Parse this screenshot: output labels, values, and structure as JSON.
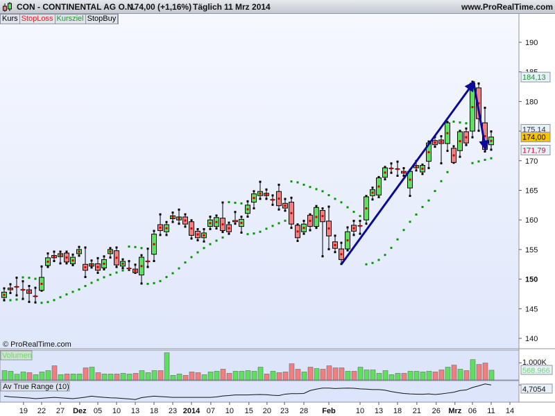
{
  "header": {
    "title": "CON - CONTINENTAL AG O.N.",
    "price_change": "174,00 (+1,16%)",
    "period": "Täglich",
    "date": "11 Mrz 2014",
    "site": "www.ProRealTime.com"
  },
  "buttons": [
    {
      "label": "Kurs",
      "color": "#000000"
    },
    {
      "label": "StopLoss",
      "color": "#e0202a"
    },
    {
      "label": "Kursziel",
      "color": "#1a9a2a"
    },
    {
      "label": "StopBuy",
      "color": "#000000"
    }
  ],
  "copyright": "© ProRealTime.com",
  "colors": {
    "up": "#5ee05e",
    "down": "#f08080",
    "sar": "#009a00",
    "mid": "#d40000",
    "arrow": "#0a0a9a"
  },
  "price_axis": {
    "ticks": [
      190,
      185,
      180,
      175,
      170,
      165,
      160,
      155,
      150,
      145,
      140
    ],
    "bold_tick": 150,
    "range": [
      139,
      194
    ]
  },
  "price_labels": [
    {
      "text": "184,13",
      "value": 184.13,
      "fg": "#1a9a2a",
      "bg": "#e8f0f8"
    },
    {
      "text": "175,14",
      "value": 175.3,
      "fg": "#333333",
      "bg": "#e8f0f8"
    },
    {
      "text": "174,00",
      "value": 174.0,
      "fg": "#000000",
      "bg": "#f5c400"
    },
    {
      "text": "171,79",
      "value": 171.79,
      "fg": "#d01040",
      "bg": "#e8f0f8"
    }
  ],
  "candles": [
    [
      146.9,
      148.5,
      146.4,
      147.8
    ],
    [
      148.2,
      149.2,
      147.6,
      148.5
    ],
    [
      148.7,
      150.3,
      147.2,
      148.7
    ],
    [
      148.2,
      149.7,
      146.6,
      148.2
    ],
    [
      148.2,
      148.9,
      146.1,
      147.6
    ],
    [
      147.1,
      148.6,
      146.0,
      147.1
    ],
    [
      148.1,
      152.2,
      148.0,
      150.3
    ],
    [
      152.3,
      154.4,
      152.0,
      153.6
    ],
    [
      154.0,
      154.7,
      153.0,
      153.6
    ],
    [
      153.8,
      154.7,
      152.6,
      154.3
    ],
    [
      154.4,
      154.7,
      152.6,
      152.9
    ],
    [
      152.6,
      154.2,
      152.3,
      153.7
    ],
    [
      154.3,
      155.5,
      153.9,
      155.0
    ],
    [
      152.5,
      155.4,
      150.3,
      151.5
    ],
    [
      152.2,
      153.2,
      151.9,
      152.6
    ],
    [
      152.6,
      153.6,
      151.0,
      151.5
    ],
    [
      151.9,
      153.9,
      151.6,
      153.3
    ],
    [
      154.3,
      155.3,
      153.6,
      155.0
    ],
    [
      154.8,
      155.4,
      152.0,
      152.4
    ],
    [
      152.2,
      153.4,
      151.8,
      153.0
    ],
    [
      151.8,
      153.1,
      151.5,
      151.8
    ],
    [
      151.7,
      152.5,
      151.0,
      151.1
    ],
    [
      150.7,
      154.1,
      149.2,
      153.7
    ],
    [
      153.0,
      155.2,
      152.0,
      153.0
    ],
    [
      154.2,
      158.2,
      153.0,
      157.6
    ],
    [
      159.2,
      161.0,
      157.4,
      158.2
    ],
    [
      158.0,
      159.7,
      157.4,
      159.2
    ],
    [
      160.2,
      161.3,
      159.6,
      160.7
    ],
    [
      160.0,
      161.8,
      159.3,
      160.5
    ],
    [
      160.5,
      161.0,
      158.8,
      159.3
    ],
    [
      159.7,
      160.0,
      156.8,
      157.4
    ],
    [
      158.1,
      158.5,
      156.5,
      157.0
    ],
    [
      157.0,
      158.5,
      156.3,
      157.8
    ],
    [
      158.9,
      160.6,
      158.4,
      160.0
    ],
    [
      158.9,
      160.8,
      158.5,
      160.4
    ],
    [
      160.3,
      163.0,
      157.9,
      158.2
    ],
    [
      159.2,
      159.6,
      157.6,
      158.0
    ],
    [
      159.7,
      161.4,
      159.3,
      159.9
    ],
    [
      158.9,
      160.6,
      157.8,
      160.1
    ],
    [
      161.1,
      163.2,
      160.5,
      162.5
    ],
    [
      163.0,
      164.9,
      161.9,
      164.4
    ],
    [
      164.1,
      166.5,
      163.5,
      164.8
    ],
    [
      164.5,
      165.2,
      163.5,
      164.1
    ],
    [
      163.4,
      164.2,
      162.5,
      163.4
    ],
    [
      164.8,
      166.0,
      161.7,
      162.4
    ],
    [
      162.8,
      163.6,
      161.5,
      162.0
    ],
    [
      163.0,
      163.8,
      158.6,
      159.3
    ],
    [
      159.1,
      159.3,
      156.4,
      157.0
    ],
    [
      158.0,
      159.9,
      157.6,
      159.3
    ],
    [
      160.8,
      161.0,
      158.2,
      158.9
    ],
    [
      158.9,
      162.4,
      158.6,
      162.1
    ],
    [
      161.6,
      162.0,
      153.8,
      159.7
    ],
    [
      159.8,
      162.3,
      155.0,
      157.3
    ],
    [
      156.3,
      157.4,
      154.5,
      155.2
    ],
    [
      155.1,
      156.2,
      152.5,
      153.3
    ],
    [
      155.1,
      158.8,
      154.8,
      158.0
    ],
    [
      159.1,
      159.9,
      157.4,
      158.1
    ],
    [
      159.0,
      159.9,
      157.6,
      159.0
    ],
    [
      160.0,
      164.1,
      159.3,
      163.9
    ],
    [
      164.1,
      165.5,
      163.4,
      165.1
    ],
    [
      164.2,
      167.3,
      163.8,
      167.1
    ],
    [
      167.2,
      169.0,
      166.8,
      168.8
    ],
    [
      168.7,
      169.6,
      167.9,
      168.7
    ],
    [
      168.6,
      169.9,
      167.4,
      168.6
    ],
    [
      168.2,
      168.8,
      167.4,
      167.9
    ],
    [
      165.4,
      168.5,
      164.0,
      168.2
    ],
    [
      168.8,
      170.0,
      168.3,
      169.2
    ],
    [
      168.1,
      169.4,
      167.7,
      169.2
    ],
    [
      169.9,
      173.3,
      168.7,
      173.0
    ],
    [
      173.4,
      174.1,
      172.3,
      172.7
    ],
    [
      173.5,
      174.2,
      169.5,
      172.9
    ],
    [
      172.9,
      176.6,
      171.6,
      176.4
    ],
    [
      172.1,
      172.5,
      169.6,
      169.7
    ],
    [
      171.7,
      175.1,
      170.6,
      174.9
    ],
    [
      174.9,
      175.5,
      172.6,
      173.0
    ],
    [
      175.0,
      183.4,
      173.9,
      183.1
    ],
    [
      182.3,
      183.1,
      175.0,
      177.1
    ],
    [
      176.4,
      179.0,
      171.5,
      171.9
    ],
    [
      172.7,
      175.0,
      171.8,
      174.0
    ]
  ],
  "arrow_points": [
    [
      54,
      152.5
    ],
    [
      75.2,
      183.2
    ],
    [
      77.1,
      172.0
    ]
  ],
  "volume": {
    "label": "Volumen",
    "tick_label": "1.000K",
    "tick_value": 1000,
    "last_label": "568.966",
    "max": 1700,
    "values": [
      547,
      507,
      333,
      467,
      427,
      307,
      467,
      547,
      827,
      307,
      347,
      347,
      347,
      707,
      747,
      427,
      347,
      347,
      347,
      387,
      347,
      387,
      547,
      427,
      547,
      547,
      1587,
      267,
      347,
      267,
      467,
      427,
      307,
      467,
      507,
      627,
      387,
      507,
      507,
      547,
      507,
      747,
      347,
      507,
      427,
      467,
      947,
      627,
      467,
      747,
      667,
      627,
      827,
      707,
      707,
      507,
      507,
      747,
      587,
      587,
      387,
      547,
      307,
      387,
      387,
      507,
      507,
      467,
      507,
      467,
      587,
      747,
      867,
      627,
      547,
      1187,
      907,
      987,
      569
    ]
  },
  "atr": {
    "label": "Av True Range (10)",
    "last_label": "4,7054",
    "range": [
      2.5,
      5.1
    ],
    "values": [
      3.21,
      3.12,
      3.07,
      3.01,
      2.96,
      2.87,
      2.93,
      2.99,
      3.04,
      2.99,
      2.93,
      2.87,
      2.96,
      3.07,
      3.21,
      3.12,
      3.04,
      2.99,
      2.96,
      2.9,
      2.84,
      2.76,
      3.01,
      3.12,
      3.21,
      3.15,
      3.1,
      3.04,
      3.04,
      3.04,
      3.04,
      3.04,
      3.04,
      3.04,
      3.1,
      3.23,
      3.29,
      3.37,
      3.37,
      3.37,
      3.4,
      3.43,
      3.4,
      3.32,
      3.29,
      3.48,
      3.54,
      3.54,
      3.57,
      3.96,
      4.15,
      4.29,
      4.29,
      4.23,
      4.26,
      4.29,
      4.26,
      4.18,
      4.15,
      4.09,
      4.09,
      4.01,
      3.82,
      3.68,
      3.57,
      3.51,
      3.48,
      3.46,
      3.51,
      3.43,
      3.51,
      3.62,
      3.73,
      3.96,
      4.04,
      4.37,
      4.59,
      4.84,
      4.7054
    ]
  },
  "date_labels": [
    {
      "t": "19",
      "i": 3.1,
      "b": false
    },
    {
      "t": "22",
      "i": 6,
      "b": false
    },
    {
      "t": "27",
      "i": 9,
      "b": false
    },
    {
      "t": "Dez",
      "i": 12.1,
      "b": true
    },
    {
      "t": "05",
      "i": 15,
      "b": false
    },
    {
      "t": "10",
      "i": 18,
      "b": false
    },
    {
      "t": "13",
      "i": 21,
      "b": false
    },
    {
      "t": "18",
      "i": 24,
      "b": false
    },
    {
      "t": "23",
      "i": 27,
      "b": false
    },
    {
      "t": "2014",
      "i": 30,
      "b": true
    },
    {
      "t": "07",
      "i": 33.1,
      "b": false
    },
    {
      "t": "10",
      "i": 36.1,
      "b": false
    },
    {
      "t": "15",
      "i": 39.2,
      "b": false
    },
    {
      "t": "20",
      "i": 42.1,
      "b": false
    },
    {
      "t": "23",
      "i": 44.9,
      "b": false
    },
    {
      "t": "28",
      "i": 48,
      "b": false
    },
    {
      "t": "Feb",
      "i": 52,
      "b": true
    },
    {
      "t": "10",
      "i": 57,
      "b": false
    },
    {
      "t": "13",
      "i": 60,
      "b": false
    },
    {
      "t": "18",
      "i": 63,
      "b": false
    },
    {
      "t": "21",
      "i": 66.1,
      "b": false
    },
    {
      "t": "26",
      "i": 69.2,
      "b": false
    },
    {
      "t": "Mrz",
      "i": 72.2,
      "b": true
    },
    {
      "t": "06",
      "i": 75,
      "b": false
    },
    {
      "t": "11",
      "i": 78,
      "b": false
    },
    {
      "t": "14",
      "i": 81,
      "b": false
    }
  ]
}
